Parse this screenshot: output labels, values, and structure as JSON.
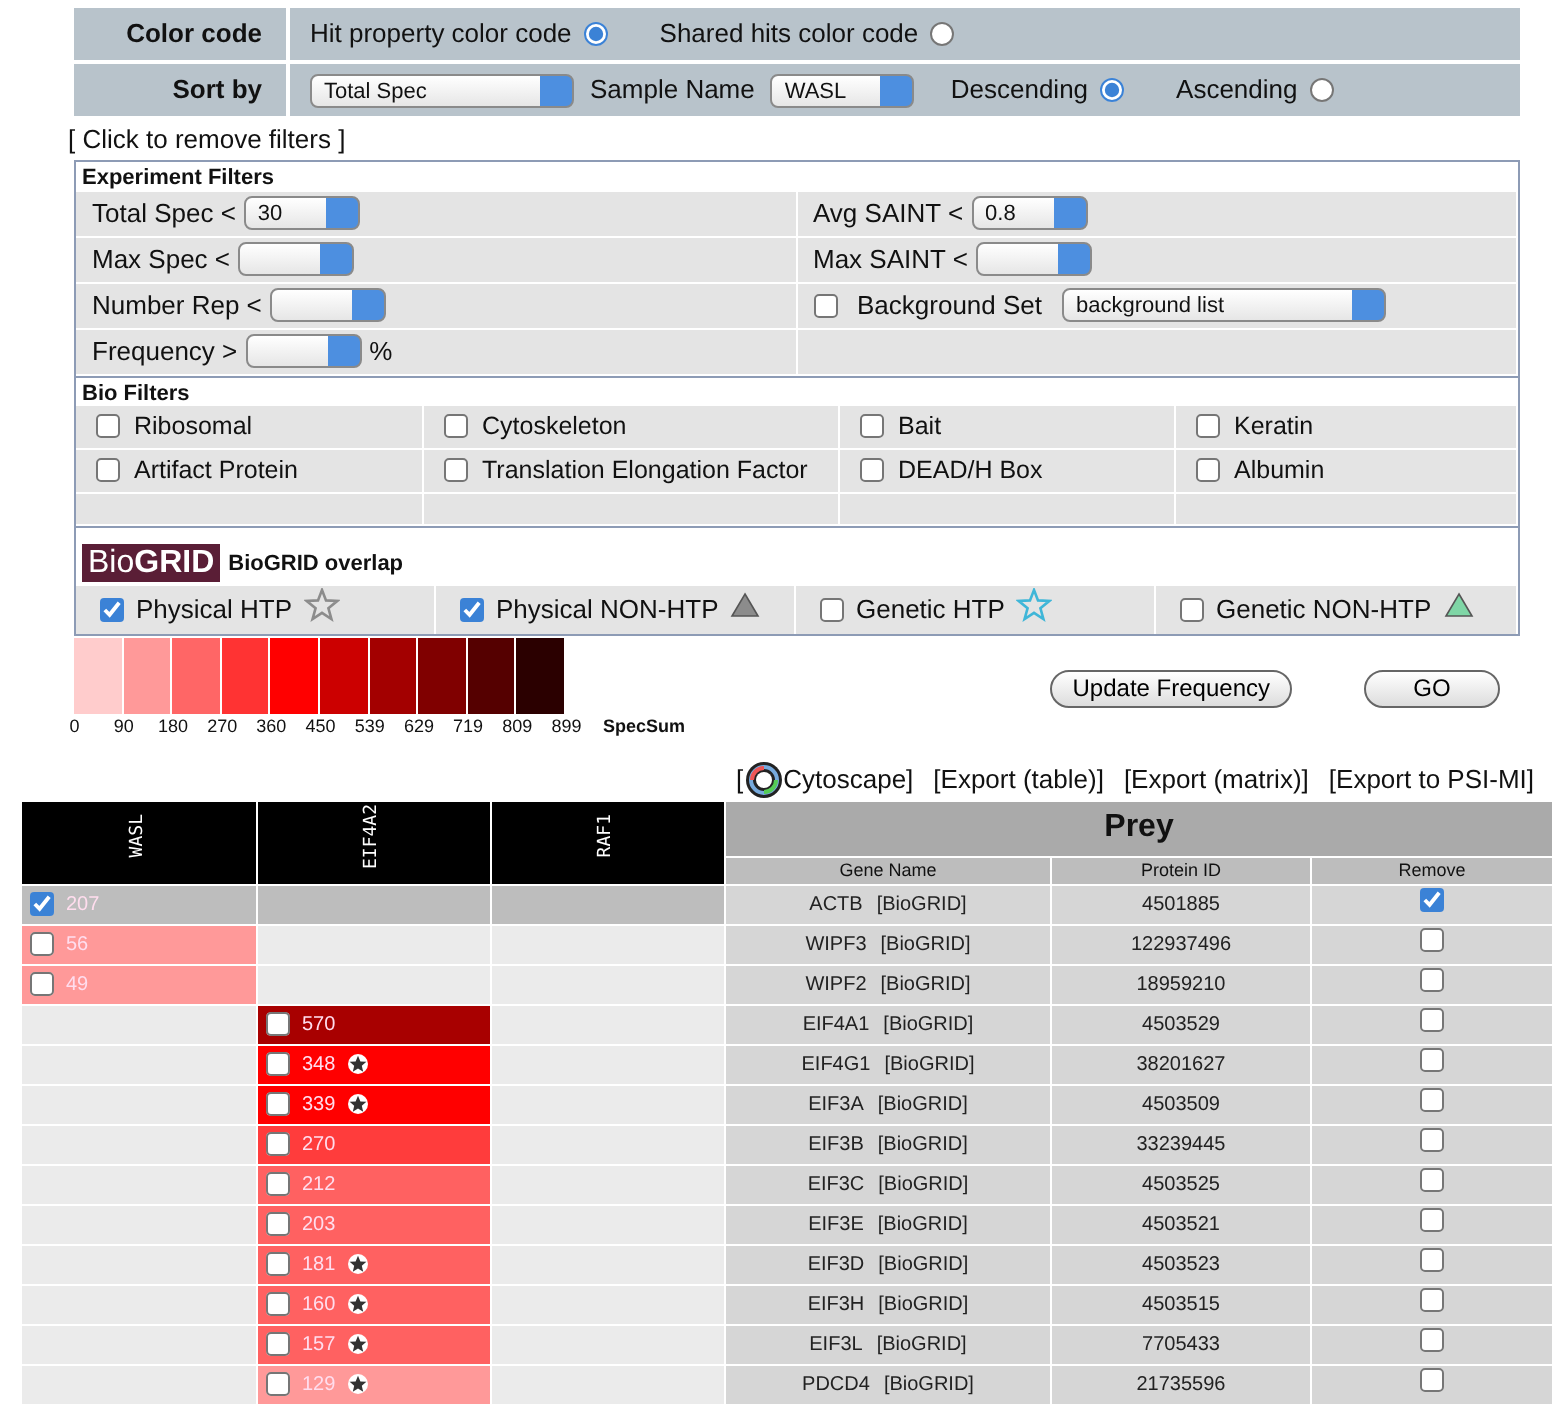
{
  "color_code": {
    "label": "Color code",
    "options": [
      {
        "label": "Hit property color code",
        "selected": true
      },
      {
        "label": "Shared hits color code",
        "selected": false
      }
    ]
  },
  "sort_by": {
    "label": "Sort by",
    "sort_field": "Total Spec",
    "sample_label": "Sample Name",
    "sample": "WASL",
    "orders": [
      {
        "label": "Descending",
        "selected": true
      },
      {
        "label": "Ascending",
        "selected": false
      }
    ]
  },
  "remove_filters_link": "[ Click to remove filters ]",
  "experiment_filters": {
    "title": "Experiment Filters",
    "items": [
      {
        "kind": "select",
        "label": "Total Spec <",
        "value": "30"
      },
      {
        "kind": "select",
        "label": "Avg SAINT <",
        "value": "0.8"
      },
      {
        "kind": "select",
        "label": "Max Spec <"
      },
      {
        "kind": "select",
        "label": "Max SAINT <"
      },
      {
        "kind": "select",
        "label": "Number Rep <"
      },
      {
        "kind": "checkbox_select",
        "label": "Background Set",
        "checked": false,
        "value": "background list"
      },
      {
        "kind": "select",
        "label": "Frequency >",
        "suffix": "%"
      }
    ]
  },
  "bio_filters": {
    "title": "Bio Filters",
    "items": [
      {
        "label": "Ribosomal",
        "checked": false
      },
      {
        "label": "Cytoskeleton",
        "checked": false
      },
      {
        "label": "Bait",
        "checked": false
      },
      {
        "label": "Keratin",
        "checked": false
      },
      {
        "label": "Artifact Protein",
        "checked": false
      },
      {
        "label": "Translation Elongation Factor",
        "checked": false
      },
      {
        "label": "DEAD/H Box",
        "checked": false
      },
      {
        "label": "Albumin",
        "checked": false
      }
    ]
  },
  "biogrid": {
    "logo": "Bio**GRID**",
    "title": "BioGRID overlap",
    "items": [
      {
        "label": "Physical HTP",
        "checked": true,
        "kind": "star",
        "color": "#8c8c8c"
      },
      {
        "label": "Physical NON-HTP",
        "checked": true,
        "kind": "triangle",
        "color": "#8c8c8c"
      },
      {
        "label": "Genetic HTP",
        "checked": false,
        "kind": "star",
        "color": "#3fb6d8"
      },
      {
        "label": "Genetic NON-HTP",
        "checked": false,
        "kind": "triangle",
        "color": "#7fd6a6"
      }
    ]
  },
  "legend": {
    "swatches": [
      {
        "color": "#ffcccc"
      },
      {
        "color": "#ff9999"
      },
      {
        "color": "#ff6666"
      },
      {
        "color": "#ff3333"
      },
      {
        "color": "#ff0000"
      },
      {
        "color": "#cc0000"
      },
      {
        "color": "#a30000"
      },
      {
        "color": "#800000"
      },
      {
        "color": "#550000"
      },
      {
        "color": "#2b0000"
      }
    ],
    "ticks": [
      "0",
      "90",
      "180",
      "270",
      "360",
      "450",
      "539",
      "629",
      "719",
      "809",
      "899"
    ],
    "title": "SpecSum"
  },
  "buttons": [
    "Update Frequency",
    "GO"
  ],
  "cytoscape": {
    "bracket": "[",
    "label": "Cytoscape]"
  },
  "exports": [
    "[Export (table)]",
    "[Export (matrix)]",
    "[Export to PSI-MI]"
  ],
  "matrix": {
    "baits": [
      "WASL",
      "EIF4A2",
      "RAF1"
    ],
    "prey_title": "Prey",
    "columns": [
      "Gene Name",
      "Protein ID",
      "Remove"
    ],
    "rows": [
      {
        "cells": [
          {
            "kind": "hit",
            "value": "207",
            "checked": true,
            "starred": false
          },
          {
            "kind": "empty"
          },
          {
            "kind": "empty"
          }
        ],
        "gene": "ACTB",
        "link": "[BioGRID]",
        "protein_id": "4501885",
        "remove": true
      },
      {
        "cells": [
          {
            "kind": "hit",
            "value": "56",
            "checked": false,
            "starred": false,
            "color": "#ff9999"
          },
          {
            "kind": "empty"
          },
          {
            "kind": "empty"
          }
        ],
        "gene": "WIPF3",
        "link": "[BioGRID]",
        "protein_id": "122937496",
        "remove": false
      },
      {
        "cells": [
          {
            "kind": "hit",
            "value": "49",
            "checked": false,
            "starred": false,
            "color": "#ff9999"
          },
          {
            "kind": "empty"
          },
          {
            "kind": "empty"
          }
        ],
        "gene": "WIPF2",
        "link": "[BioGRID]",
        "protein_id": "18959210",
        "remove": false
      },
      {
        "cells": [
          {
            "kind": "empty"
          },
          {
            "kind": "hit",
            "value": "570",
            "checked": false,
            "starred": false,
            "color": "#a80000"
          },
          {
            "kind": "empty"
          }
        ],
        "gene": "EIF4A1",
        "link": "[BioGRID]",
        "protein_id": "4503529",
        "remove": false
      },
      {
        "cells": [
          {
            "kind": "empty"
          },
          {
            "kind": "hit",
            "value": "348",
            "checked": false,
            "starred": true,
            "color": "#ff0000"
          },
          {
            "kind": "empty"
          }
        ],
        "gene": "EIF4G1",
        "link": "[BioGRID]",
        "protein_id": "38201627",
        "remove": false
      },
      {
        "cells": [
          {
            "kind": "empty"
          },
          {
            "kind": "hit",
            "value": "339",
            "checked": false,
            "starred": true,
            "color": "#ff0000"
          },
          {
            "kind": "empty"
          }
        ],
        "gene": "EIF3A",
        "link": "[BioGRID]",
        "protein_id": "4503509",
        "remove": false
      },
      {
        "cells": [
          {
            "kind": "empty"
          },
          {
            "kind": "hit",
            "value": "270",
            "checked": false,
            "starred": false,
            "color": "#ff3c3c"
          },
          {
            "kind": "empty"
          }
        ],
        "gene": "EIF3B",
        "link": "[BioGRID]",
        "protein_id": "33239445",
        "remove": false
      },
      {
        "cells": [
          {
            "kind": "empty"
          },
          {
            "kind": "hit",
            "value": "212",
            "checked": false,
            "starred": false,
            "color": "#ff6161"
          },
          {
            "kind": "empty"
          }
        ],
        "gene": "EIF3C",
        "link": "[BioGRID]",
        "protein_id": "4503525",
        "remove": false
      },
      {
        "cells": [
          {
            "kind": "empty"
          },
          {
            "kind": "hit",
            "value": "203",
            "checked": false,
            "starred": false,
            "color": "#ff6161"
          },
          {
            "kind": "empty"
          }
        ],
        "gene": "EIF3E",
        "link": "[BioGRID]",
        "protein_id": "4503521",
        "remove": false
      },
      {
        "cells": [
          {
            "kind": "empty"
          },
          {
            "kind": "hit",
            "value": "181",
            "checked": false,
            "starred": true,
            "color": "#ff6161"
          },
          {
            "kind": "empty"
          }
        ],
        "gene": "EIF3D",
        "link": "[BioGRID]",
        "protein_id": "4503523",
        "remove": false
      },
      {
        "cells": [
          {
            "kind": "empty"
          },
          {
            "kind": "hit",
            "value": "160",
            "checked": false,
            "starred": true,
            "color": "#ff6161"
          },
          {
            "kind": "empty"
          }
        ],
        "gene": "EIF3H",
        "link": "[BioGRID]",
        "protein_id": "4503515",
        "remove": false
      },
      {
        "cells": [
          {
            "kind": "empty"
          },
          {
            "kind": "hit",
            "value": "157",
            "checked": false,
            "starred": true,
            "color": "#ff6161"
          },
          {
            "kind": "empty"
          }
        ],
        "gene": "EIF3L",
        "link": "[BioGRID]",
        "protein_id": "7705433",
        "remove": false
      },
      {
        "cells": [
          {
            "kind": "empty"
          },
          {
            "kind": "hit",
            "value": "129",
            "checked": false,
            "starred": true,
            "color": "#ff9999"
          },
          {
            "kind": "empty"
          }
        ],
        "gene": "PDCD4",
        "link": "[BioGRID]",
        "protein_id": "21735596",
        "remove": false
      }
    ]
  }
}
